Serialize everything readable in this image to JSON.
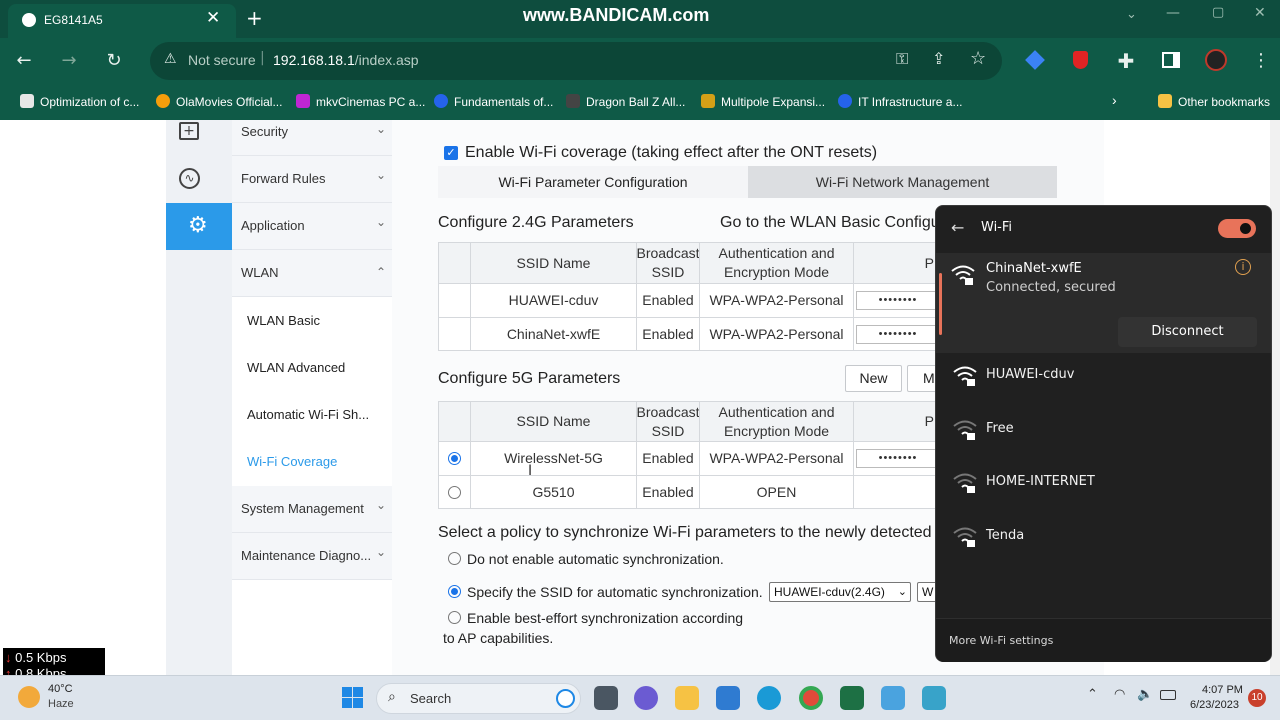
{
  "browser": {
    "tab_title": "EG8141A5",
    "watermark": "www.BANDICAM.com",
    "security": "Not secure",
    "url_host": "192.168.18.1",
    "url_path": "/index.asp",
    "bookmarks": [
      "Optimization of c...",
      "OlaMovies Official...",
      "mkvCinemas PC a...",
      "Fundamentals of...",
      "Dragon Ball Z All...",
      "Multipole Expansi...",
      "IT Infrastructure a..."
    ],
    "other_bookmarks": "Other bookmarks"
  },
  "sidebar": {
    "menu": [
      {
        "label": "Security",
        "icon": "first-aid-icon"
      },
      {
        "label": "Forward Rules",
        "icon": "pulse-icon"
      },
      {
        "label": "Application",
        "icon": "gear-icon"
      },
      {
        "label": "WLAN",
        "icon": ""
      }
    ],
    "sub": [
      "WLAN Basic",
      "WLAN Advanced",
      "Automatic Wi-Fi Sh...",
      "Wi-Fi Coverage"
    ],
    "after": [
      "System Management",
      "Maintenance Diagno..."
    ]
  },
  "main": {
    "enable_label": "Enable Wi-Fi coverage (taking effect after the ONT resets)",
    "tabs": [
      "Wi-Fi Parameter Configuration",
      "Wi-Fi Network Management"
    ],
    "section24": "Configure 2.4G Parameters",
    "goto_link": "Go to the WLAN Basic Configu",
    "headers": {
      "ssid": "SSID Name",
      "broadcast": "Broadcast SSID",
      "auth": "Authentication and Encryption Mode",
      "pass": "P"
    },
    "rows24": [
      {
        "ssid": "HUAWEI-cduv",
        "broadcast": "Enabled",
        "auth": "WPA-WPA2-Personal",
        "pass": "••••••••"
      },
      {
        "ssid": "ChinaNet-xwfE",
        "broadcast": "Enabled",
        "auth": "WPA-WPA2-Personal",
        "pass": "••••••••"
      }
    ],
    "section5": "Configure 5G Parameters",
    "new_button": "New",
    "m_button": "M",
    "rows5": [
      {
        "ssid": "WirelessNet-5G",
        "broadcast": "Enabled",
        "auth": "WPA-WPA2-Personal",
        "pass": "••••••••"
      },
      {
        "ssid": "G5510",
        "broadcast": "Enabled",
        "auth": "OPEN",
        "pass": ""
      }
    ],
    "policy_text": "Select a policy to synchronize Wi-Fi parameters to the newly detected",
    "opt1": "Do not enable automatic synchronization.",
    "opt2": "Specify the SSID for automatic synchronization.",
    "opt2_select": "HUAWEI-cduv(2.4G)",
    "opt2_select2": "W",
    "opt3a": "Enable best-effort synchronization according",
    "opt3b": "to AP capabilities."
  },
  "netmeter": {
    "down": "0.5 Kbps",
    "up": "0.8 Kbps"
  },
  "wifi_flyout": {
    "title": "Wi-Fi",
    "connected_name": "ChinaNet-xwfE",
    "connected_status": "Connected, secured",
    "disconnect": "Disconnect",
    "networks": [
      "HUAWEI-cduv",
      "Free",
      "HOME-INTERNET",
      "Tenda"
    ],
    "more": "More Wi-Fi settings"
  },
  "taskbar": {
    "temp": "40°C",
    "weather": "Haze",
    "search": "Search",
    "time": "4:07 PM",
    "date": "6/23/2023",
    "notif_count": "10"
  }
}
